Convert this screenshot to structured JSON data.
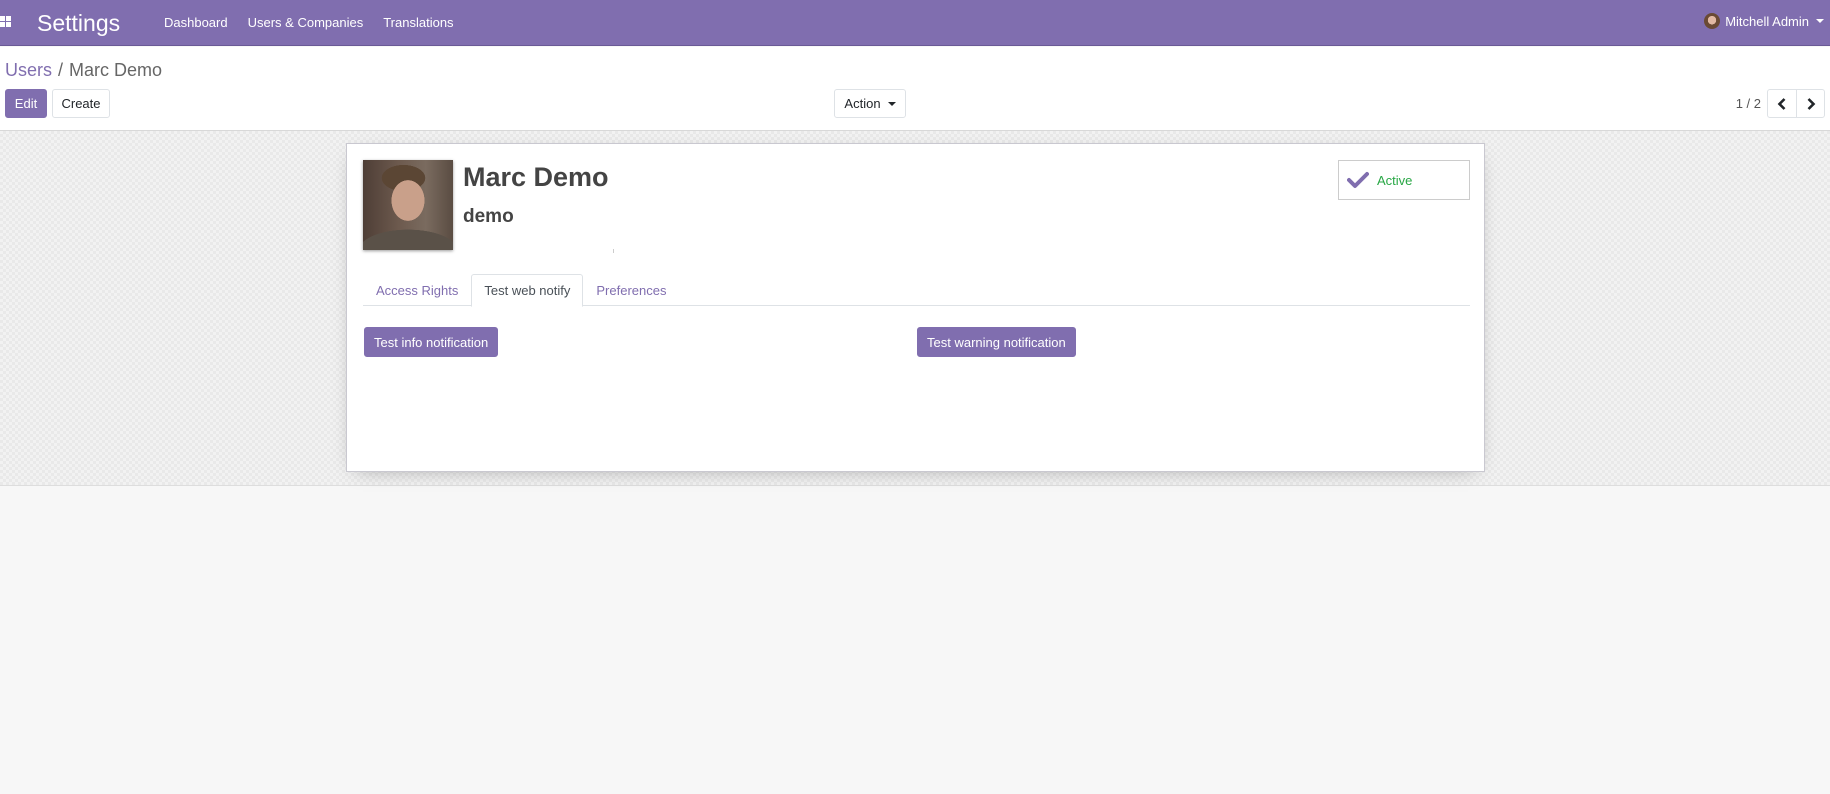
{
  "navbar": {
    "app_title": "Settings",
    "menu": [
      "Dashboard",
      "Users & Companies",
      "Translations"
    ],
    "user_name": "Mitchell Admin",
    "icons": {
      "apps": "apps-grid-icon",
      "caret": "caret-down-icon"
    },
    "color": "#806eaf"
  },
  "breadcrumb": {
    "parent": "Users",
    "separator": "/",
    "current": "Marc Demo"
  },
  "toolbar": {
    "edit_label": "Edit",
    "create_label": "Create",
    "action_label": "Action"
  },
  "pager": {
    "value": "1 / 2",
    "prev_icon": "chevron-left-icon",
    "next_icon": "chevron-right-icon"
  },
  "record": {
    "name": "Marc Demo",
    "login": "demo",
    "active_label": "Active",
    "active": true
  },
  "tabs": [
    {
      "label": "Access Rights",
      "active": false
    },
    {
      "label": "Test web notify",
      "active": true
    },
    {
      "label": "Preferences",
      "active": false
    }
  ],
  "tab_content": {
    "info_button": "Test info notification",
    "warning_button": "Test warning notification"
  },
  "colors": {
    "primary": "#806eaf",
    "success": "#28a745"
  }
}
